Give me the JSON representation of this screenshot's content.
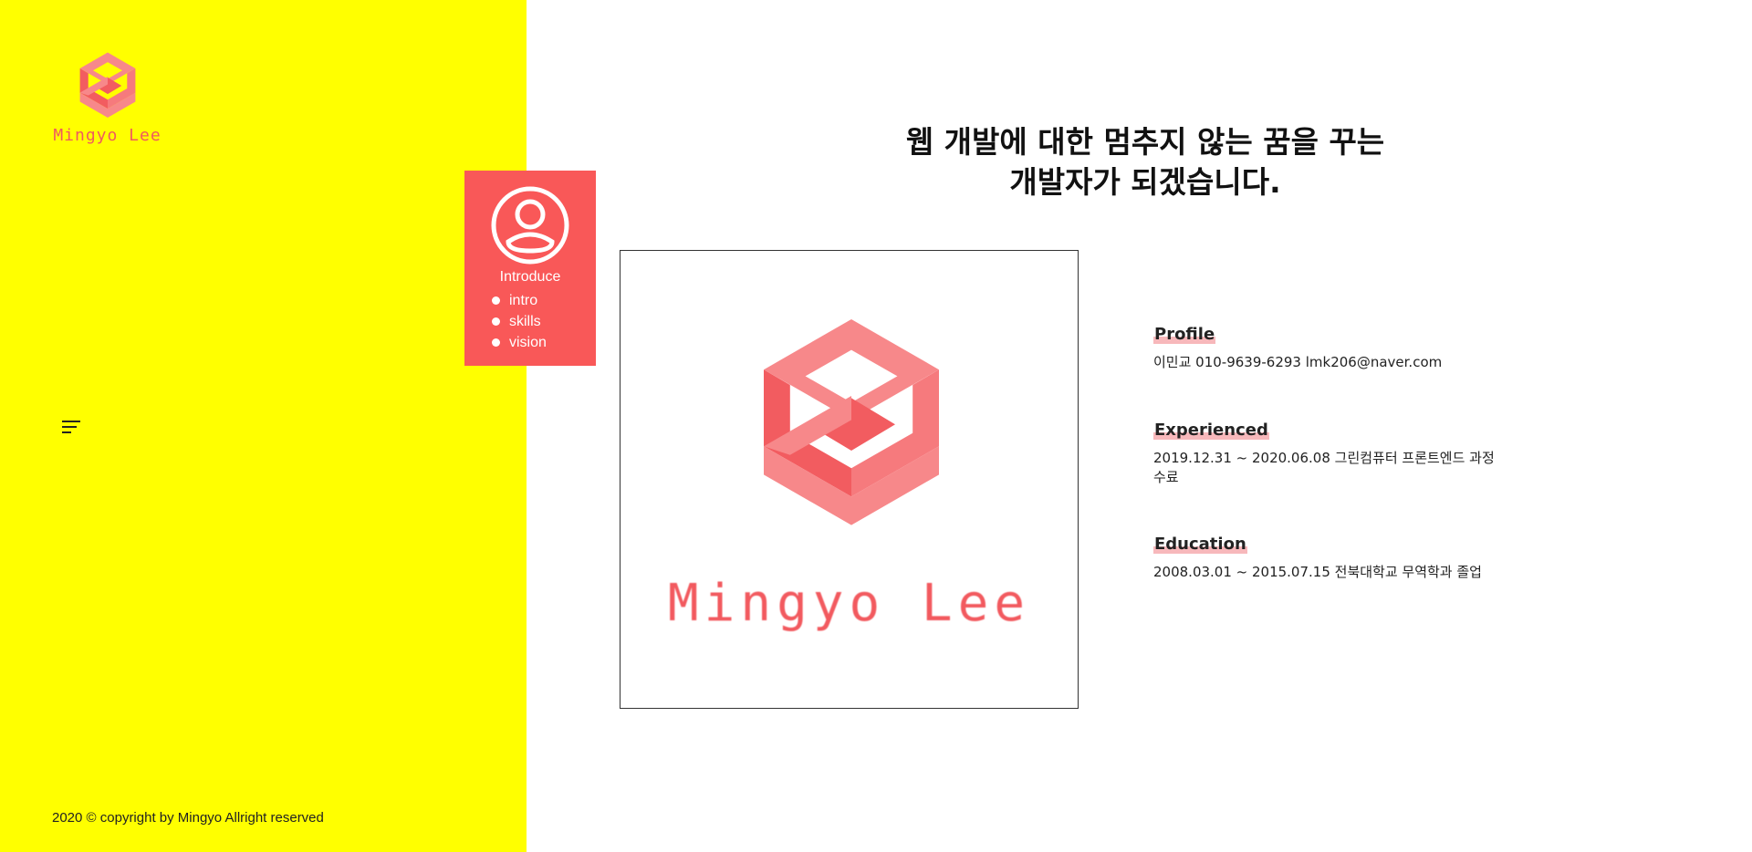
{
  "brand": {
    "name": "Mingyo Lee",
    "logo_icon": "stacked-chevron-logo",
    "accent_color": "#f95858"
  },
  "sidebar": {
    "background_color": "#ffff00",
    "menu_icon": "hamburger-menu-icon",
    "copyright": "2020 © copyright by Mingyo Allright reserved"
  },
  "menu": {
    "icon": "user-circle-icon",
    "title": "Introduce",
    "items": [
      {
        "label": "intro"
      },
      {
        "label": "skills"
      },
      {
        "label": "vision"
      }
    ]
  },
  "main": {
    "headline_line1": "웹 개발에 대한 멈추지 않는 꿈을 꾸는",
    "headline_line2": "개발자가 되겠습니다.",
    "photo_caption": "Mingyo Lee",
    "sections": {
      "profile": {
        "title": "Profile",
        "text": "이민교 010-9639-6293 lmk206@naver.com"
      },
      "experienced": {
        "title": "Experienced",
        "text": "2019.12.31 ~ 2020.06.08 그린컴퓨터 프론트엔드 과정 수료"
      },
      "education": {
        "title": "Education",
        "text": "2008.03.01 ~ 2015.07.15 전북대학교 무역학과 졸업"
      }
    }
  }
}
